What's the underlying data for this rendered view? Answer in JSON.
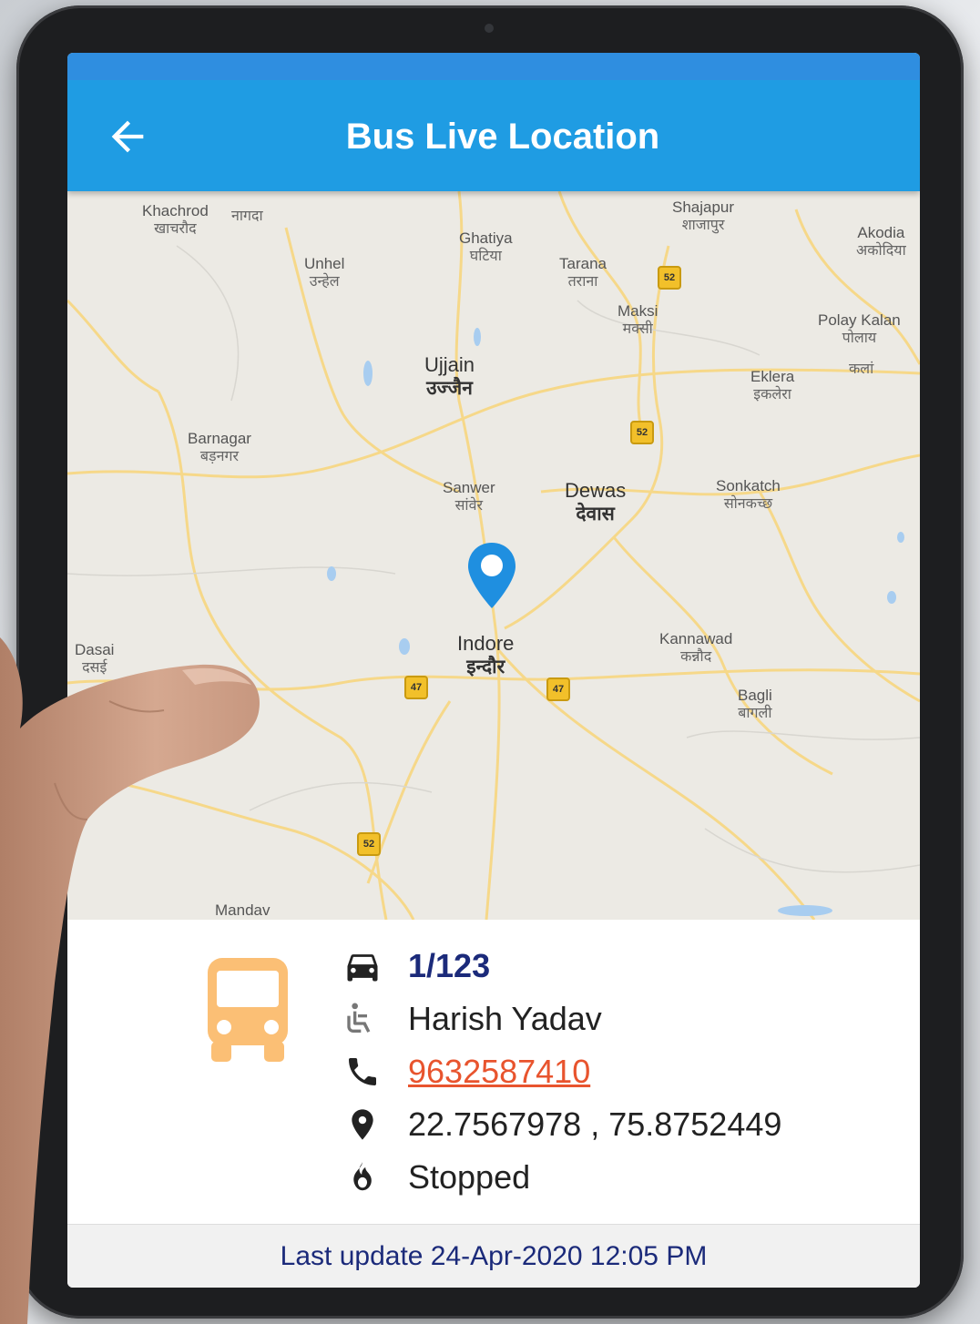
{
  "appbar": {
    "title": "Bus Live Location",
    "back_icon": "arrow-back-icon",
    "color": "#1f9ce3"
  },
  "map": {
    "places": [
      {
        "name": "Khachrod",
        "hindi": "खाचरौद"
      },
      {
        "name": "",
        "hindi": "नागदा"
      },
      {
        "name": "Unhel",
        "hindi": "उन्हेल"
      },
      {
        "name": "Ghatiya",
        "hindi": "घटिया"
      },
      {
        "name": "Tarana",
        "hindi": "तराना"
      },
      {
        "name": "Shajapur",
        "hindi": "शाजापुर"
      },
      {
        "name": "Akodia",
        "hindi": "अकोदिया"
      },
      {
        "name": "Maksi",
        "hindi": "मक्सी"
      },
      {
        "name": "Polay Kalan",
        "hindi": "पोलाय"
      },
      {
        "name": "",
        "hindi": "कलां"
      },
      {
        "name": "Ujjain",
        "hindi": "उज्जैन"
      },
      {
        "name": "Eklera",
        "hindi": "इकलेरा"
      },
      {
        "name": "Barnagar",
        "hindi": "बड़नगर"
      },
      {
        "name": "Sanwer",
        "hindi": "सांवेर"
      },
      {
        "name": "Dewas",
        "hindi": "देवास"
      },
      {
        "name": "Sonkatch",
        "hindi": "सोनकच्छ"
      },
      {
        "name": "Indore",
        "hindi": "इन्दौर"
      },
      {
        "name": "Kannawad",
        "hindi": "कन्नौद"
      },
      {
        "name": "Dasai",
        "hindi": "दसई"
      },
      {
        "name": "Bagli",
        "hindi": "बागली"
      },
      {
        "name": "Mandav",
        "hindi": ""
      }
    ],
    "highways": [
      "52",
      "52",
      "47",
      "47",
      "52"
    ],
    "pin_icon": "map-pin-icon",
    "pin_color": "#1f8fe0"
  },
  "info": {
    "bus_icon": "bus-icon",
    "bus_icon_color": "#fbbf75",
    "bus_number_icon": "car-icon",
    "bus_number": "1/123",
    "driver_icon": "driver-seat-icon",
    "driver_name": "Harish Yadav",
    "phone_icon": "phone-icon",
    "phone": "9632587410",
    "location_icon": "location-pin-icon",
    "coordinates": "22.7567978 , 75.8752449",
    "status_icon": "ignition-fire-icon",
    "status": "Stopped"
  },
  "footer": {
    "last_update": "Last update 24-Apr-2020 12:05 PM"
  }
}
